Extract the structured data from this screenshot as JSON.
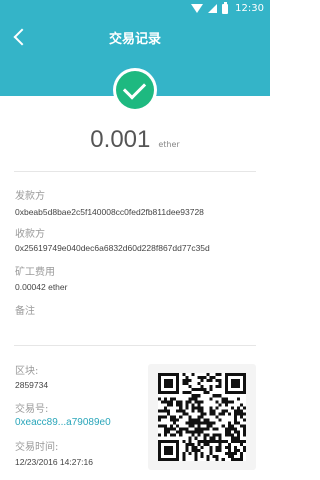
{
  "status_bar": {
    "time": "12:30",
    "icons": [
      "wifi-icon",
      "signal-icon",
      "battery-icon"
    ]
  },
  "header": {
    "title": "交易记录",
    "back_icon": "chevron-left-icon",
    "color": "#34b4c8"
  },
  "status": {
    "icon": "check-icon",
    "color": "#1eb980"
  },
  "amount": {
    "value": "0.001",
    "unit": "ether"
  },
  "details": {
    "from_label": "发款方",
    "from_value": "0xbeab5d8bae2c5f140008cc0fed2fb811dee93728",
    "to_label": "收款方",
    "to_value": "0x25619749e040dec6a6832d60d228f867dd77c35d",
    "fee_label": "矿工费用",
    "fee_value": "0.00042 ether",
    "note_label": "备注"
  },
  "block": {
    "block_label": "区块:",
    "block_value": "2859734",
    "txid_label": "交易号:",
    "txid_value": "0xeacc89...a79089e0",
    "time_label": "交易时间:",
    "time_value": "12/23/2016 14:27:16"
  }
}
